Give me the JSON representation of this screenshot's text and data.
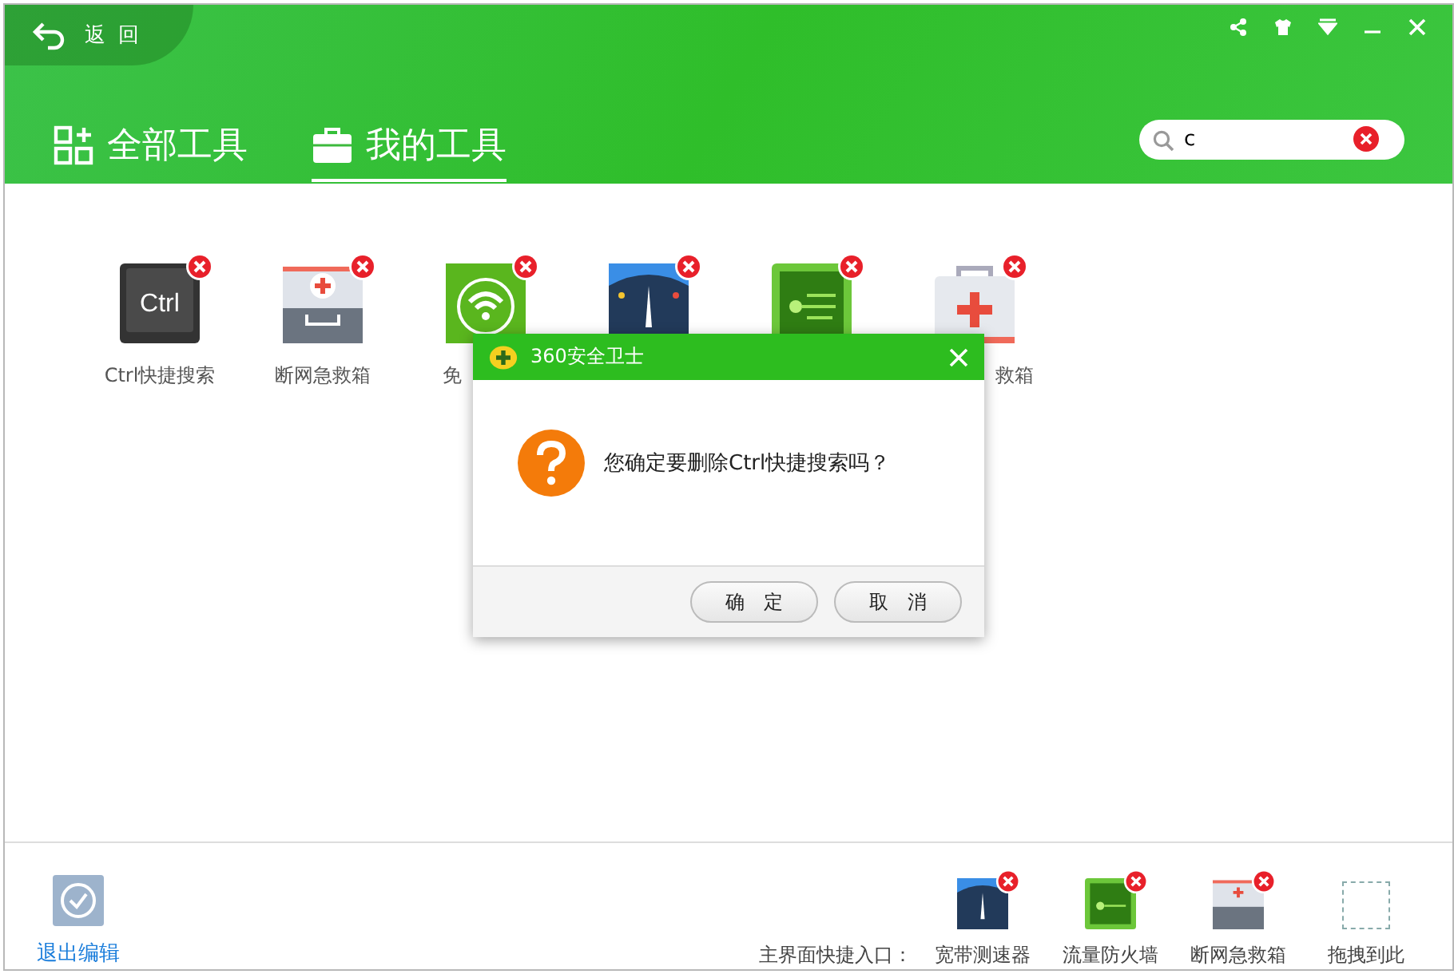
{
  "back": {
    "label": "返 回"
  },
  "tabs": [
    {
      "label": "全部工具",
      "selected": false,
      "kind": "grid"
    },
    {
      "label": "我的工具",
      "selected": true,
      "kind": "briefcase"
    }
  ],
  "search": {
    "value": "c"
  },
  "tools": [
    {
      "kind": "ctrl",
      "icon_text": "Ctrl",
      "label": "Ctrl快捷搜索"
    },
    {
      "kind": "firstaid",
      "label": "断网急救箱"
    },
    {
      "kind": "wifi",
      "label": "免"
    },
    {
      "kind": "speed"
    },
    {
      "kind": "firewall"
    },
    {
      "kind": "kit",
      "label": "救箱"
    }
  ],
  "dialog": {
    "title": "360安全卫士",
    "message": "您确定要删除Ctrl快捷搜索吗？",
    "buttons": [
      "确　定",
      "取　消"
    ]
  },
  "footer": {
    "exit_label": "退出编辑",
    "shortcut_label": "主界面快捷入口：",
    "shortcuts": [
      {
        "kind": "speed",
        "label": "宽带测速器"
      },
      {
        "kind": "firewall",
        "label": "流量防火墙"
      },
      {
        "kind": "firstaid",
        "label": "断网急救箱"
      }
    ],
    "drop_label": "拖拽到此"
  }
}
